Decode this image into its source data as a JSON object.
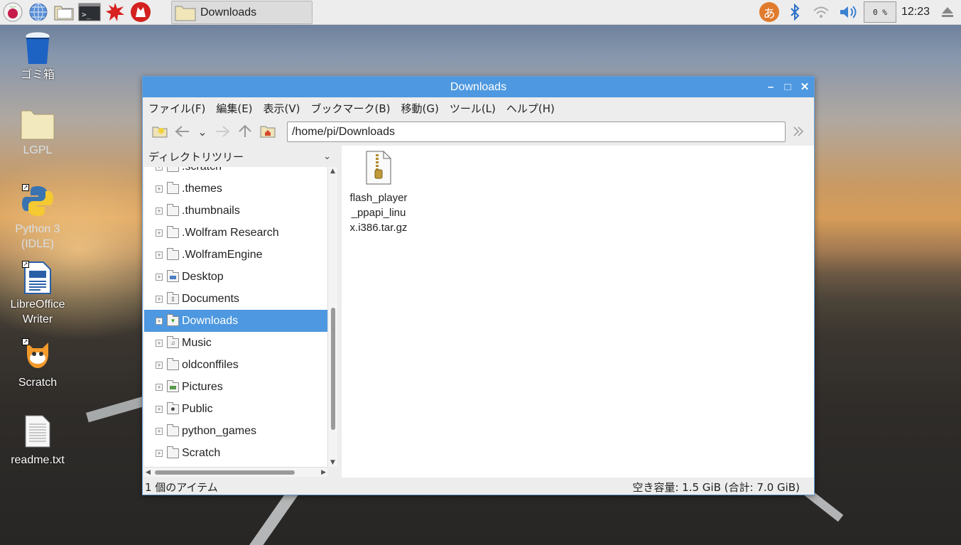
{
  "panel": {
    "launchers": [
      "raspberry-menu-icon",
      "web-browser-icon",
      "file-manager-icon",
      "terminal-icon",
      "mathematica-icon",
      "wolfram-icon"
    ],
    "task": {
      "label": "Downloads"
    },
    "tray": {
      "ime": "あ",
      "cpu": "0 %",
      "clock": "12:23"
    }
  },
  "desktop": {
    "icons": [
      {
        "label": "ゴミ箱",
        "icon": "trash-icon"
      },
      {
        "label": "LGPL",
        "icon": "folder-icon"
      },
      {
        "label": "Python 3\n(IDLE)",
        "l1": "Python 3",
        "l2": "(IDLE)",
        "icon": "python-icon"
      },
      {
        "l1": "LibreOffice",
        "l2": "Writer",
        "icon": "writer-icon"
      },
      {
        "label": "Scratch",
        "icon": "scratch-icon"
      },
      {
        "label": "readme.txt",
        "icon": "text-file-icon"
      }
    ]
  },
  "window": {
    "title": "Downloads",
    "menu": [
      "ファイル(F)",
      "編集(E)",
      "表示(V)",
      "ブックマーク(B)",
      "移動(G)",
      "ツール(L)",
      "ヘルプ(H)"
    ],
    "path": "/home/pi/Downloads",
    "sidebar": {
      "header": "ディレクトリツリー",
      "partial_top": ".scratch",
      "items": [
        {
          "label": ".themes",
          "icon": "folder-icon"
        },
        {
          "label": ".thumbnails",
          "icon": "folder-icon"
        },
        {
          "label": ".Wolfram Research",
          "icon": "folder-icon"
        },
        {
          "label": ".WolframEngine",
          "icon": "folder-icon"
        },
        {
          "label": "Desktop",
          "icon": "desktop-folder-icon"
        },
        {
          "label": "Documents",
          "icon": "documents-folder-icon"
        },
        {
          "label": "Downloads",
          "icon": "downloads-folder-icon",
          "selected": true
        },
        {
          "label": "Music",
          "icon": "music-folder-icon"
        },
        {
          "label": "oldconffiles",
          "icon": "folder-icon"
        },
        {
          "label": "Pictures",
          "icon": "pictures-folder-icon"
        },
        {
          "label": "Public",
          "icon": "public-folder-icon"
        },
        {
          "label": "python_games",
          "icon": "folder-icon"
        },
        {
          "label": "Scratch",
          "icon": "folder-icon"
        }
      ]
    },
    "files": [
      {
        "l1": "flash_player",
        "l2": "_ppapi_linu",
        "l3": "x.i386.tar.gz",
        "icon": "archive-icon"
      }
    ],
    "status": {
      "left": "1 個のアイテム",
      "right": "空き容量: 1.5 GiB (合計: 7.0 GiB)"
    }
  }
}
